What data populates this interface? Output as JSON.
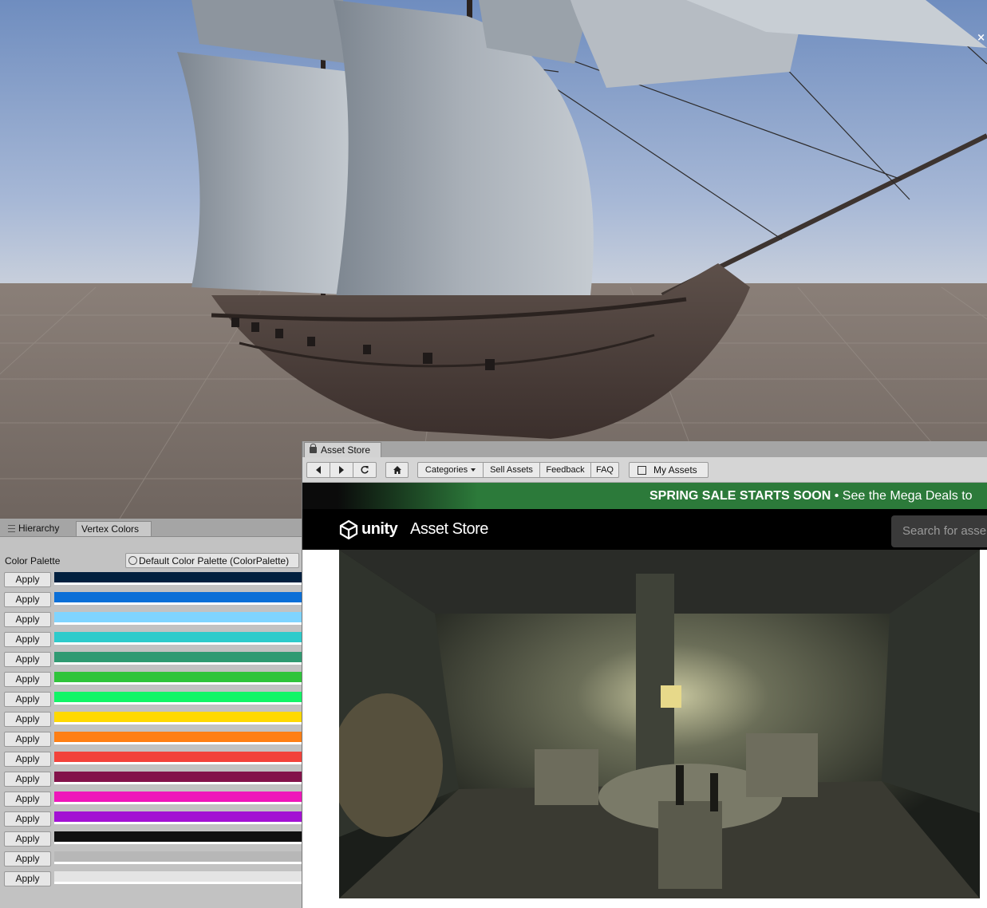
{
  "scene_view": {
    "close_glyph": "×"
  },
  "left_panel": {
    "tabs": [
      {
        "label": "Hierarchy"
      },
      {
        "label": "Vertex Colors"
      }
    ],
    "color_palette_label": "Color Palette",
    "color_palette_value": "Default Color Palette (ColorPalette)",
    "apply_label": "Apply",
    "swatches": [
      "#01203f",
      "#0b6fd7",
      "#7fd4ff",
      "#2ecbcb",
      "#2f9a72",
      "#2fc43b",
      "#11f567",
      "#ffd900",
      "#ff7f14",
      "#f2423b",
      "#83124a",
      "#ee17ba",
      "#a311d3",
      "#101010",
      "#b7b7b7",
      "#e4e4e4"
    ]
  },
  "asset_store": {
    "tab_label": "Asset Store",
    "toolbar": {
      "categories": "Categories",
      "sell_assets": "Sell Assets",
      "feedback": "Feedback",
      "faq": "FAQ",
      "my_assets": "My Assets"
    },
    "banner": {
      "bold": "SPRING SALE STARTS SOON",
      "separator": " • ",
      "rest": "See the Mega Deals to"
    },
    "logo": {
      "unity": "unity",
      "store": "Asset Store"
    },
    "search_placeholder": "Search for asse"
  }
}
